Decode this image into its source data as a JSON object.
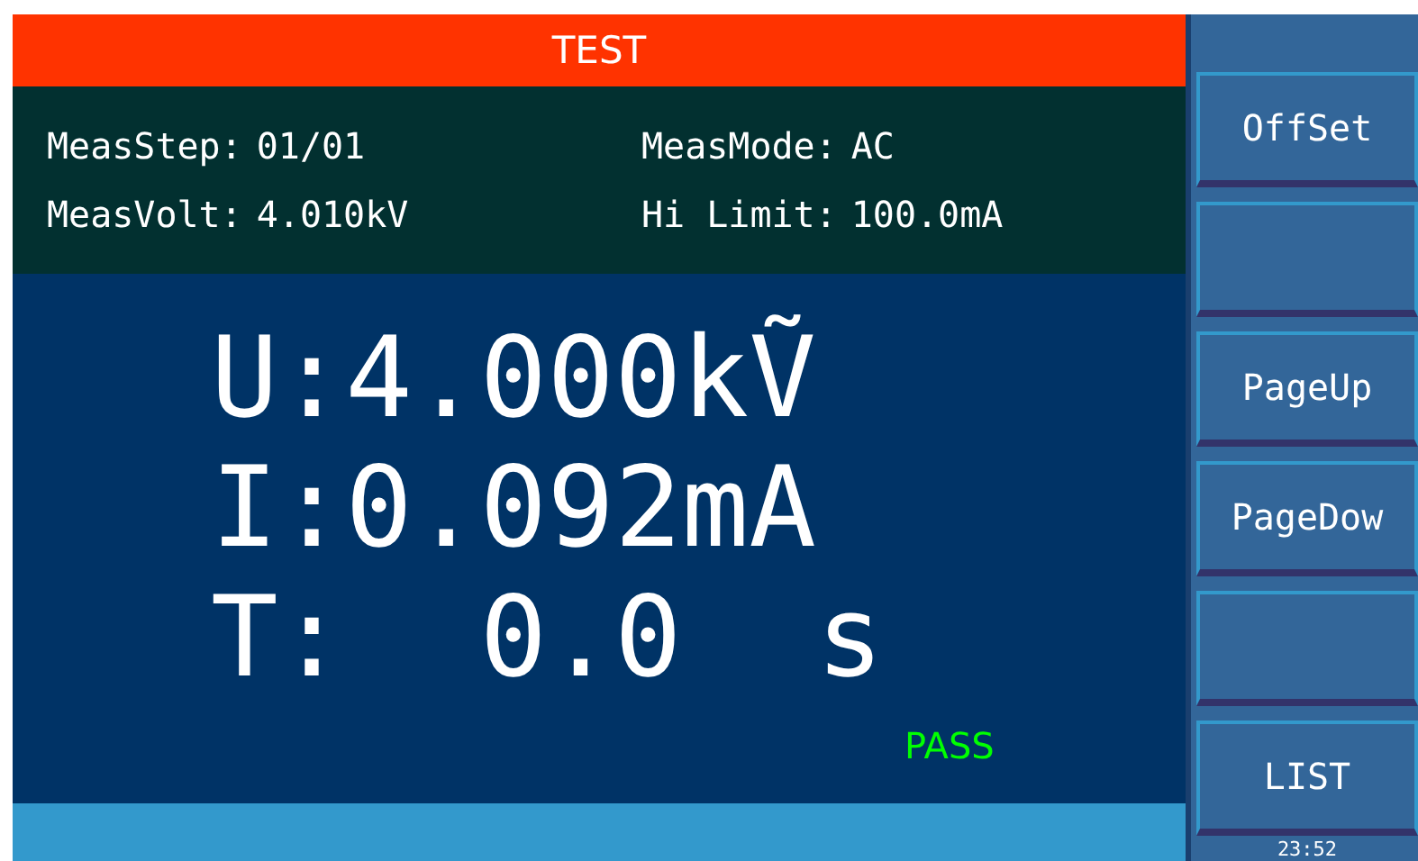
{
  "title": "TEST",
  "info": [
    {
      "label": "MeasStep:",
      "value": "01/01"
    },
    {
      "label": "MeasMode:",
      "value": "AC"
    },
    {
      "label": "MeasVolt:",
      "value": "4.010kV"
    },
    {
      "label": "Hi Limit:",
      "value": "100.0mA"
    }
  ],
  "readings": [
    "U:4.000kṼ",
    "I:0.092mA",
    "T:  0.0  s"
  ],
  "result": "PASS",
  "softkeys": [
    {
      "kind": "text",
      "label": "OffSet"
    },
    {
      "kind": "blank"
    },
    {
      "kind": "text",
      "label": "PageUp"
    },
    {
      "kind": "text",
      "label": "PageDow"
    },
    {
      "kind": "blank"
    },
    {
      "kind": "text",
      "label": "LIST"
    }
  ],
  "clock": "23:52"
}
